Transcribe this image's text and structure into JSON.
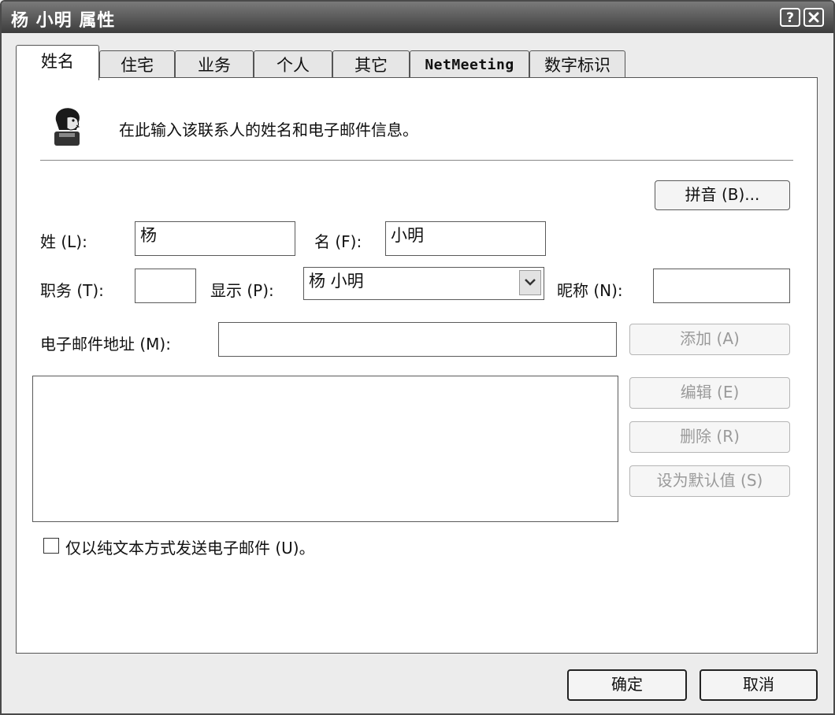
{
  "window": {
    "title": "杨 小明 属性"
  },
  "titlebar": {
    "help": "?",
    "close": "✕"
  },
  "tabs": [
    {
      "label": "姓名",
      "active": true
    },
    {
      "label": "住宅",
      "active": false
    },
    {
      "label": "业务",
      "active": false
    },
    {
      "label": "个人",
      "active": false
    },
    {
      "label": "其它",
      "active": false
    },
    {
      "label": "NetMeeting",
      "active": false
    },
    {
      "label": "数字标识",
      "active": false
    }
  ],
  "header": {
    "icon": "contact-person-icon",
    "description": "在此输入该联系人的姓名和电子邮件信息。"
  },
  "pinyin_button": "拼音 (B)...",
  "fields": {
    "surname": {
      "label": "姓 (L):",
      "value": "杨"
    },
    "given_name": {
      "label": "名 (F):",
      "value": "小明"
    },
    "title": {
      "label": "职务 (T):",
      "value": ""
    },
    "display": {
      "label": "显示 (P):",
      "value": "杨 小明"
    },
    "nickname": {
      "label": "昵称 (N):",
      "value": ""
    },
    "email": {
      "label": "电子邮件地址 (M):",
      "value": ""
    }
  },
  "email_buttons": {
    "add": "添加 (A)",
    "edit": "编辑 (E)",
    "delete": "删除 (R)",
    "set_default": "设为默认值 (S)"
  },
  "plain_text_checkbox": {
    "label": "仅以纯文本方式发送电子邮件 (U)。",
    "checked": false
  },
  "footer": {
    "ok": "确定",
    "cancel": "取消"
  }
}
